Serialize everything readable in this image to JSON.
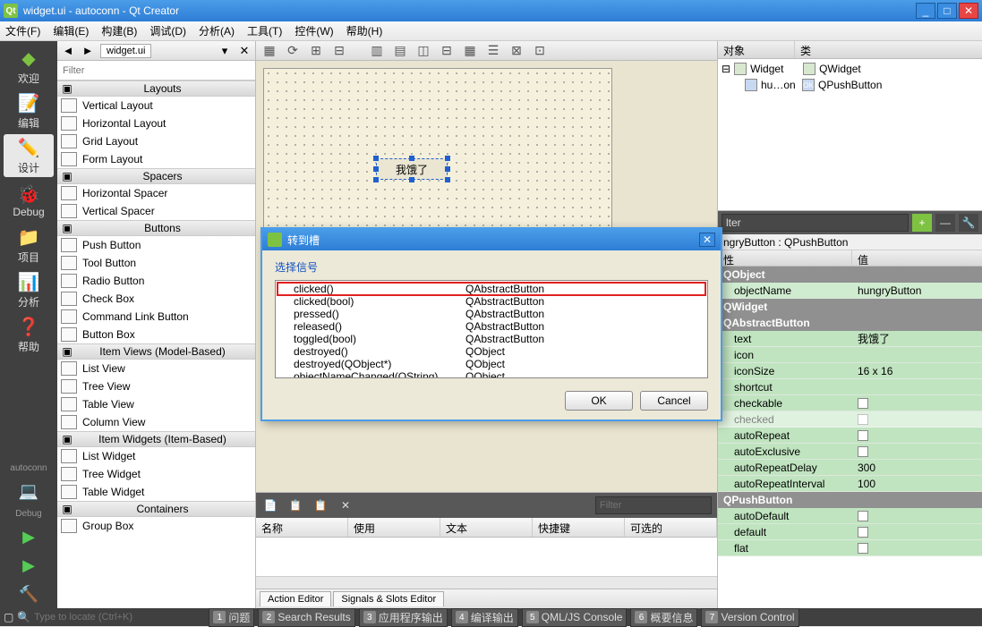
{
  "title": "widget.ui - autoconn - Qt Creator",
  "menu": [
    "文件(F)",
    "编辑(E)",
    "构建(B)",
    "调试(D)",
    "分析(A)",
    "工具(T)",
    "控件(W)",
    "帮助(H)"
  ],
  "sidebar": {
    "items": [
      {
        "label": "欢迎",
        "icon": "◆"
      },
      {
        "label": "编辑",
        "icon": "✎"
      },
      {
        "label": "设计",
        "icon": "✏"
      },
      {
        "label": "Debug",
        "icon": "🐞"
      },
      {
        "label": "项目",
        "icon": "📁"
      },
      {
        "label": "分析",
        "icon": "📊"
      },
      {
        "label": "帮助",
        "icon": "❓"
      }
    ],
    "project": "autoconn",
    "debug": "Debug"
  },
  "widgetbox": {
    "tab": "widget.ui",
    "filter": "Filter",
    "cats": [
      {
        "name": "Layouts",
        "items": [
          "Vertical Layout",
          "Horizontal Layout",
          "Grid Layout",
          "Form Layout"
        ]
      },
      {
        "name": "Spacers",
        "items": [
          "Horizontal Spacer",
          "Vertical Spacer"
        ]
      },
      {
        "name": "Buttons",
        "items": [
          "Push Button",
          "Tool Button",
          "Radio Button",
          "Check Box",
          "Command Link Button",
          "Button Box"
        ]
      },
      {
        "name": "Item Views (Model-Based)",
        "items": [
          "List View",
          "Tree View",
          "Table View",
          "Column View"
        ]
      },
      {
        "name": "Item Widgets (Item-Based)",
        "items": [
          "List Widget",
          "Tree Widget",
          "Table Widget"
        ]
      },
      {
        "name": "Containers",
        "items": [
          "Group Box"
        ]
      }
    ]
  },
  "form": {
    "button_text": "我饿了"
  },
  "actions": {
    "filter": "Filter",
    "cols": [
      "名称",
      "使用",
      "文本",
      "快捷键",
      "可选的"
    ],
    "tabs": [
      "Action Editor",
      "Signals & Slots Editor"
    ]
  },
  "objtree": {
    "cols": [
      "对象",
      "类"
    ],
    "rows": [
      {
        "name": "Widget",
        "cls": "QWidget",
        "indent": 0
      },
      {
        "name": "hu…on",
        "cls": "QPushButton",
        "indent": 1
      }
    ]
  },
  "props": {
    "filter": "lter",
    "title": "ngryButton : QPushButton",
    "cols": [
      "性",
      "值"
    ],
    "sections": [
      {
        "name": "QObject",
        "rows": [
          {
            "k": "objectName",
            "v": "hungryButton"
          }
        ],
        "cls": "g"
      },
      {
        "name": "QWidget",
        "rows": [],
        "cls": "g"
      },
      {
        "name": "QAbstractButton",
        "rows": [
          {
            "k": "text",
            "v": "我饿了"
          },
          {
            "k": "icon",
            "v": ""
          },
          {
            "k": "iconSize",
            "v": "16 x 16"
          },
          {
            "k": "shortcut",
            "v": ""
          },
          {
            "k": "checkable",
            "v": "",
            "cb": true
          },
          {
            "k": "checked",
            "v": "",
            "cb": true,
            "dis": true
          },
          {
            "k": "autoRepeat",
            "v": "",
            "cb": true
          },
          {
            "k": "autoExclusive",
            "v": "",
            "cb": true
          },
          {
            "k": "autoRepeatDelay",
            "v": "300"
          },
          {
            "k": "autoRepeatInterval",
            "v": "100"
          }
        ],
        "cls": "g2"
      },
      {
        "name": "QPushButton",
        "rows": [
          {
            "k": "autoDefault",
            "v": "",
            "cb": true
          },
          {
            "k": "default",
            "v": "",
            "cb": true
          },
          {
            "k": "flat",
            "v": "",
            "cb": true
          }
        ],
        "cls": "g2"
      }
    ]
  },
  "dialog": {
    "title": "转到槽",
    "label": "选择信号",
    "signals": [
      {
        "s": "clicked()",
        "c": "QAbstractButton",
        "hl": true
      },
      {
        "s": "clicked(bool)",
        "c": "QAbstractButton"
      },
      {
        "s": "pressed()",
        "c": "QAbstractButton"
      },
      {
        "s": "released()",
        "c": "QAbstractButton"
      },
      {
        "s": "toggled(bool)",
        "c": "QAbstractButton"
      },
      {
        "s": "destroyed()",
        "c": "QObject"
      },
      {
        "s": "destroyed(QObject*)",
        "c": "QObject"
      },
      {
        "s": "objectNameChanged(QString)",
        "c": "QObject"
      }
    ],
    "ok": "OK",
    "cancel": "Cancel"
  },
  "status": {
    "locate": "Type to locate (Ctrl+K)",
    "panes": [
      "问题",
      "Search Results",
      "应用程序输出",
      "编译输出",
      "QML/JS Console",
      "概要信息",
      "Version Control"
    ]
  }
}
